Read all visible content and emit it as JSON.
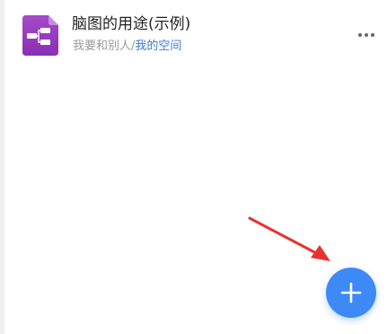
{
  "file": {
    "title": "脑图的用途(示例)",
    "owner": "我要和别人",
    "separator": "/",
    "space": "我的空间",
    "icon": "mindmap-file-icon"
  },
  "actions": {
    "more_icon": "more-dots-icon",
    "fab_icon": "plus-icon"
  },
  "colors": {
    "accent": "#3d8af7",
    "link": "#3b7bd8",
    "file_icon_purple": "#9b3fbf",
    "annotation_arrow": "#e8322f"
  }
}
